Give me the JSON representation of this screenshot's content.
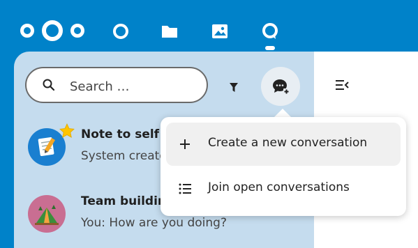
{
  "header": {
    "apps": [
      {
        "name": "dashboard",
        "icon": "circle-icon"
      },
      {
        "name": "files",
        "icon": "folder-icon"
      },
      {
        "name": "photos",
        "icon": "image-icon"
      },
      {
        "name": "talk",
        "icon": "talk-icon",
        "active": true
      }
    ],
    "brand_color": "#0082c9"
  },
  "search": {
    "placeholder": "Search …"
  },
  "conversations": [
    {
      "title": "Note to self",
      "subtitle": "System created this conversation",
      "avatar": "note-avatar"
    },
    {
      "title": "Team building",
      "subtitle": "You: How are you doing?",
      "avatar": "team-avatar"
    }
  ],
  "menu": {
    "items": [
      {
        "label": "Create a new conversation",
        "icon": "plus-icon"
      },
      {
        "label": "Join open conversations",
        "icon": "list-icon"
      }
    ]
  },
  "colors": {
    "sidebar_bg": "#c5dcee",
    "menu_hover": "#f0f0f0"
  }
}
